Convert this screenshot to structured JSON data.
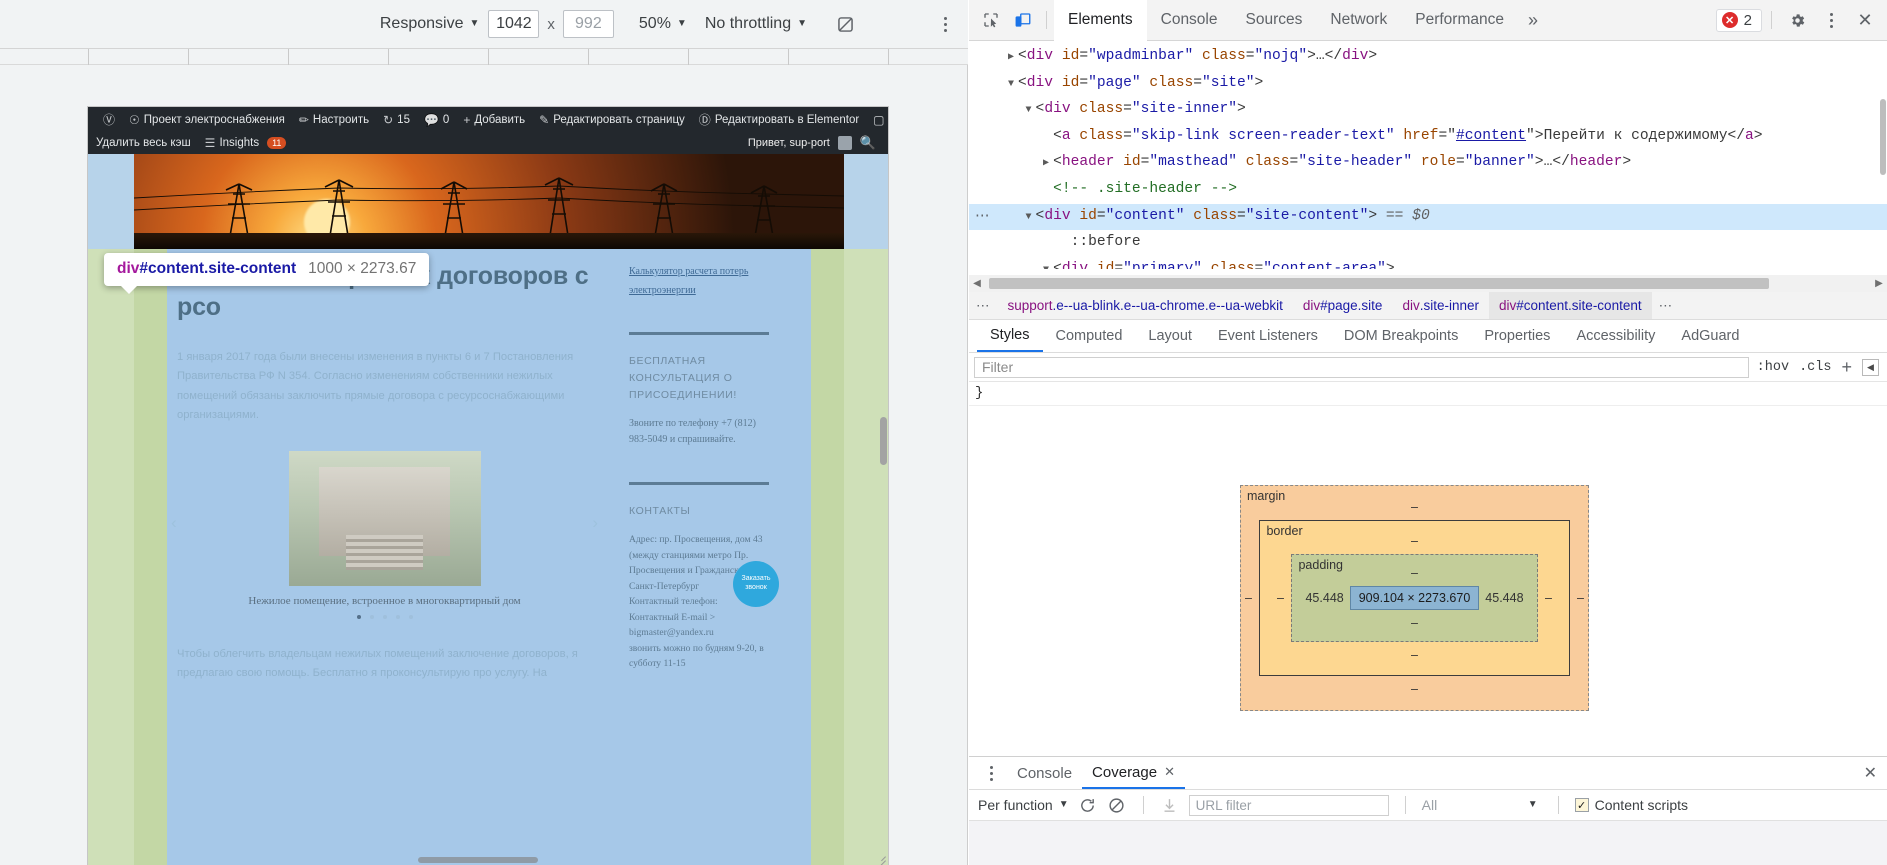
{
  "device_toolbar": {
    "device": "Responsive",
    "width": "1042",
    "height_placeholder": "992",
    "zoom": "50%",
    "throttling": "No throttling",
    "rotate_icon": "rotate-device-icon",
    "menu_icon": "more-options-icon"
  },
  "devtools": {
    "inspect_icon": "inspect-element-icon",
    "device_toggle_icon": "device-toolbar-icon",
    "tabs": [
      {
        "label": "Elements",
        "active": true
      },
      {
        "label": "Console",
        "active": false
      },
      {
        "label": "Sources",
        "active": false
      },
      {
        "label": "Network",
        "active": false
      },
      {
        "label": "Performance",
        "active": false
      }
    ],
    "more_tabs_icon": "chevron-double-right-icon",
    "error_count": "2",
    "error_icon": "error-badge-icon",
    "settings_icon": "gear-icon",
    "main_menu_icon": "more-options-icon",
    "close_icon": "close-icon"
  },
  "dom_tree": {
    "lines": [
      {
        "indent": 1,
        "tri": "▶",
        "parts": [
          {
            "t": "punct",
            "s": "<"
          },
          {
            "t": "tag",
            "s": "div"
          },
          {
            "t": "attr",
            "s": " id"
          },
          {
            "t": "punct",
            "s": "="
          },
          {
            "t": "val",
            "s": "\"wpadminbar\""
          },
          {
            "t": "attr",
            "s": " class"
          },
          {
            "t": "punct",
            "s": "="
          },
          {
            "t": "val",
            "s": "\"nojq\""
          },
          {
            "t": "punct",
            "s": ">"
          },
          {
            "t": "txt",
            "s": "…"
          },
          {
            "t": "punct",
            "s": "</"
          },
          {
            "t": "tag",
            "s": "div"
          },
          {
            "t": "punct",
            "s": ">"
          }
        ]
      },
      {
        "indent": 1,
        "tri": "▼",
        "parts": [
          {
            "t": "punct",
            "s": "<"
          },
          {
            "t": "tag",
            "s": "div"
          },
          {
            "t": "attr",
            "s": " id"
          },
          {
            "t": "punct",
            "s": "="
          },
          {
            "t": "val",
            "s": "\"page\""
          },
          {
            "t": "attr",
            "s": " class"
          },
          {
            "t": "punct",
            "s": "="
          },
          {
            "t": "val",
            "s": "\"site\""
          },
          {
            "t": "punct",
            "s": ">"
          }
        ]
      },
      {
        "indent": 2,
        "tri": "▼",
        "parts": [
          {
            "t": "punct",
            "s": "<"
          },
          {
            "t": "tag",
            "s": "div"
          },
          {
            "t": "attr",
            "s": " class"
          },
          {
            "t": "punct",
            "s": "="
          },
          {
            "t": "val",
            "s": "\"site-inner\""
          },
          {
            "t": "punct",
            "s": ">"
          }
        ]
      },
      {
        "indent": 3,
        "tri": "",
        "parts": [
          {
            "t": "punct",
            "s": "<"
          },
          {
            "t": "tag",
            "s": "a"
          },
          {
            "t": "attr",
            "s": " class"
          },
          {
            "t": "punct",
            "s": "="
          },
          {
            "t": "val",
            "s": "\"skip-link screen-reader-text\""
          },
          {
            "t": "attr",
            "s": " href"
          },
          {
            "t": "punct",
            "s": "="
          },
          {
            "t": "punct",
            "s": "\""
          },
          {
            "t": "lnk",
            "s": "#content"
          },
          {
            "t": "punct",
            "s": "\""
          },
          {
            "t": "punct",
            "s": ">"
          },
          {
            "t": "txt",
            "s": "Перейти к содержимому"
          },
          {
            "t": "punct",
            "s": "</"
          },
          {
            "t": "tag",
            "s": "a"
          },
          {
            "t": "punct",
            "s": ">"
          }
        ]
      },
      {
        "indent": 3,
        "tri": "▶",
        "parts": [
          {
            "t": "punct",
            "s": "<"
          },
          {
            "t": "tag",
            "s": "header"
          },
          {
            "t": "attr",
            "s": " id"
          },
          {
            "t": "punct",
            "s": "="
          },
          {
            "t": "val",
            "s": "\"masthead\""
          },
          {
            "t": "attr",
            "s": " class"
          },
          {
            "t": "punct",
            "s": "="
          },
          {
            "t": "val",
            "s": "\"site-header\""
          },
          {
            "t": "attr",
            "s": " role"
          },
          {
            "t": "punct",
            "s": "="
          },
          {
            "t": "val",
            "s": "\"banner\""
          },
          {
            "t": "punct",
            "s": ">"
          },
          {
            "t": "txt",
            "s": "…"
          },
          {
            "t": "punct",
            "s": "</"
          },
          {
            "t": "tag",
            "s": "header"
          },
          {
            "t": "punct",
            "s": ">"
          }
        ]
      },
      {
        "indent": 3,
        "tri": "",
        "parts": [
          {
            "t": "comment",
            "s": "<!-- .site-header -->"
          }
        ]
      },
      {
        "indent": 2,
        "tri": "▼",
        "selected": true,
        "gutter": "⋯",
        "parts": [
          {
            "t": "punct",
            "s": "<"
          },
          {
            "t": "tag",
            "s": "div"
          },
          {
            "t": "attr",
            "s": " id"
          },
          {
            "t": "punct",
            "s": "="
          },
          {
            "t": "val",
            "s": "\"content\""
          },
          {
            "t": "attr",
            "s": " class"
          },
          {
            "t": "punct",
            "s": "="
          },
          {
            "t": "val",
            "s": "\"site-content\""
          },
          {
            "t": "punct",
            "s": ">"
          },
          {
            "t": "dollar",
            "s": " == $0"
          }
        ]
      },
      {
        "indent": 4,
        "tri": "",
        "parts": [
          {
            "t": "txt",
            "s": "::before"
          }
        ]
      },
      {
        "indent": 3,
        "tri": "▼",
        "parts": [
          {
            "t": "punct",
            "s": "<"
          },
          {
            "t": "tag",
            "s": "div"
          },
          {
            "t": "attr",
            "s": " id"
          },
          {
            "t": "punct",
            "s": "="
          },
          {
            "t": "val",
            "s": "\"primary\""
          },
          {
            "t": "attr",
            "s": " class"
          },
          {
            "t": "punct",
            "s": "="
          },
          {
            "t": "val",
            "s": "\"content-area\""
          },
          {
            "t": "punct",
            "s": ">"
          }
        ]
      }
    ]
  },
  "breadcrumbs": {
    "overflow": "⋯",
    "items": [
      {
        "label": "support.e--ua-blink.e--ua-chrome.e--ua-webkit",
        "selected": false
      },
      {
        "label": "div#page.site",
        "selected": false
      },
      {
        "label": "div.site-inner",
        "selected": false
      },
      {
        "label": "div#content.site-content",
        "selected": true
      }
    ],
    "trailing": "⋯"
  },
  "style_tabs": [
    {
      "label": "Styles",
      "active": true
    },
    {
      "label": "Computed",
      "active": false
    },
    {
      "label": "Layout",
      "active": false
    },
    {
      "label": "Event Listeners",
      "active": false
    },
    {
      "label": "DOM Breakpoints",
      "active": false
    },
    {
      "label": "Properties",
      "active": false
    },
    {
      "label": "Accessibility",
      "active": false
    },
    {
      "label": "AdGuard",
      "active": false
    }
  ],
  "style_filter": {
    "placeholder": "Filter",
    "hov": ":hov",
    "cls": ".cls",
    "plus": "+",
    "sidebar_toggle_icon": "toggle-sidebar-icon"
  },
  "style_rules": {
    "text": "}"
  },
  "box_model": {
    "margin_label": "margin",
    "border_label": "border",
    "padding_label": "padding",
    "margin": {
      "top": "–",
      "right": "–",
      "bottom": "–",
      "left": "–"
    },
    "border": {
      "top": "–",
      "right": "–",
      "bottom": "–",
      "left": "–"
    },
    "padding": {
      "top": "–",
      "right": "45.448",
      "bottom": "–",
      "left": "45.448"
    },
    "content": "909.104 × 2273.670"
  },
  "drawer": {
    "menu_icon": "more-options-icon",
    "tabs": [
      {
        "label": "Console",
        "active": false,
        "closable": false
      },
      {
        "label": "Coverage",
        "active": true,
        "closable": true
      }
    ],
    "close_label": "✕",
    "close_drawer_icon": "close-icon",
    "coverage_toolbar": {
      "mode": "Per function",
      "reload_icon": "reload-icon",
      "clear_icon": "clear-icon",
      "export_icon": "export-icon",
      "url_filter_placeholder": "URL filter",
      "type_filter": "All",
      "content_scripts_label": "Content scripts",
      "content_scripts_checked": true
    }
  },
  "inspector_tooltip": {
    "tag": "div",
    "id_class": "#content.site-content",
    "dimensions": "1000 × 2273.67"
  },
  "wp_admin_bar": {
    "row1": [
      {
        "icon": "wordpress-logo-icon",
        "label": ""
      },
      {
        "icon": "dashboard-icon",
        "label": "Проект электроснабжения"
      },
      {
        "icon": "pencil-icon",
        "label": "Настроить"
      },
      {
        "icon": "updates-icon",
        "label": "15"
      },
      {
        "icon": "comment-icon",
        "label": "0"
      },
      {
        "icon": "plus-icon",
        "label": "Добавить"
      },
      {
        "icon": "edit-icon",
        "label": "Редактировать страницу"
      },
      {
        "icon": "elementor-icon",
        "label": "Редактировать в Elementor"
      },
      {
        "icon": "yoast-icon",
        "label": ""
      },
      {
        "icon": "status-dot-icon",
        "label": ""
      }
    ],
    "row2_left": [
      {
        "icon": "",
        "label": "Удалить весь кэш"
      },
      {
        "icon": "bars-chart-icon",
        "label": "Insights",
        "badge": "11"
      }
    ],
    "row2_right": {
      "greeting": "Привет, sup-port",
      "avatar_icon": "avatar-icon",
      "search_icon": "search-icon"
    }
  },
  "page": {
    "title": "Заключение прямых договоров с рсо",
    "paragraph1": "1 января 2017 года были внесены изменения в пункты 6 и 7 Постановления Правительства РФ N 354. Согласно изменениям собственники нежилых помещений обязаны заключить прямые договора с ресурсоснабжающими организациями.",
    "figure_caption": "Нежилое помещение, встроенное в многоквартирный дом",
    "paragraph2": "Чтобы облегчить владельцам нежилых помещений заключение договоров, я предлагаю свою помощь. Бесплатно я проконсультирую про услугу. На",
    "sidebar": {
      "link": "Калькулятор расчета потерь электроэнергии",
      "heading1": "БЕСПЛАТНАЯ КОНСУЛЬТАЦИЯ О ПРИСОЕДИНЕНИИ!",
      "text1": "Звоните по телефону +7 (812) 983-5049 и спрашивайте.",
      "heading2": "КОНТАКТЫ",
      "contacts": "Адрес: пр. Просвещения, дом 43 (между станциями метро Пр. Просвещения и Гражданский пр.)\nСанкт-Петербург\nКонтактный телефон:\nКонтактный E-mail >\nbigmaster@yandex.ru\nзвонить можно по будням 9-20, в субботу 11-15",
      "callback": "Заказать звонок"
    }
  },
  "colors": {
    "accent": "#1a73e8",
    "error": "#dd2c2c",
    "selection": "#cfe8fc",
    "tag": "#881280",
    "attr_value": "#1a1aa6",
    "attr_name": "#994500"
  }
}
